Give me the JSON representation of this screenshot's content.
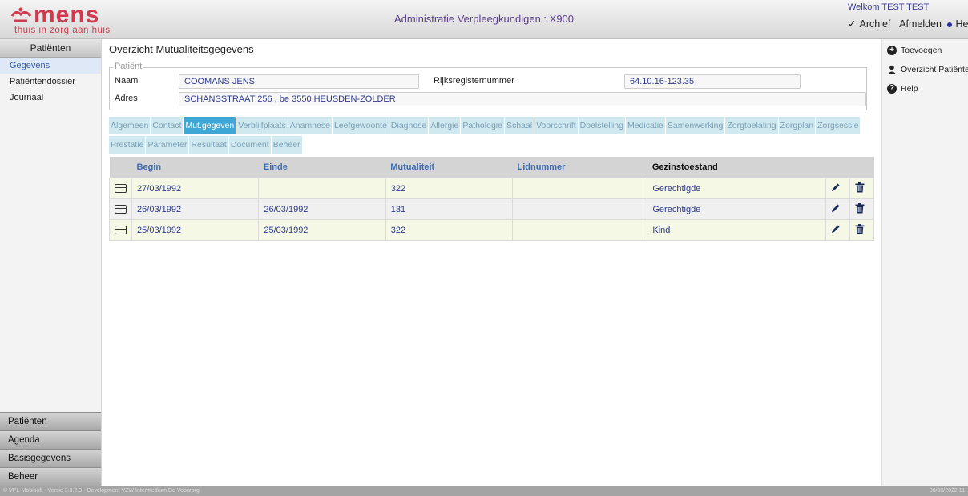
{
  "header": {
    "logo_word": "mens",
    "logo_tagline": "thuis in zorg aan huis",
    "title": "Administratie Verpleegkundigen : X900",
    "welcome": "Welkom TEST TEST",
    "nav": {
      "archief": "Archief",
      "afmelden": "Afmelden",
      "help": "Help"
    }
  },
  "leftnav": {
    "header": "Patiënten",
    "items": [
      "Gegevens",
      "Patiëntendossier",
      "Journaal"
    ],
    "bottom": [
      "Patiënten",
      "Agenda",
      "Basisgegevens",
      "Beheer"
    ]
  },
  "rightpanel": {
    "items": [
      {
        "label": "Toevoegen",
        "icon": "plus-circle-icon"
      },
      {
        "label": "Overzicht Patiënten",
        "icon": "user-icon"
      },
      {
        "label": "Help",
        "icon": "question-circle-icon"
      }
    ]
  },
  "main": {
    "title": "Overzicht Mutualiteitsgegevens",
    "patient": {
      "legend": "Patiënt",
      "naam_label": "Naam",
      "naam_value": "COOMANS JENS",
      "rijks_label": "Rijksregisternummer",
      "rijks_value": "64.10.16-123.35",
      "adres_label": "Adres",
      "adres_value": "SCHANSSTRAAT 256 , be 3550 HEUSDEN-ZOLDER"
    },
    "tabs": [
      "Algemeen",
      "Contact",
      "Mut.gegeven",
      "Verblijfplaats",
      "Anamnese",
      "Leefgewoonte",
      "Diagnose",
      "Allergie",
      "Pathologie",
      "Schaal",
      "Voorschrift",
      "Doelstelling",
      "Medicatie",
      "Samenwerking",
      "Zorgtoelating",
      "Zorgplan",
      "Zorgsessie",
      "Prestatie",
      "Parameter",
      "Resultaat",
      "Document",
      "Beheer"
    ],
    "active_tab": "Mut.gegeven",
    "table": {
      "headers": {
        "begin": "Begin",
        "einde": "Einde",
        "mutualiteit": "Mutualiteit",
        "lidnummer": "Lidnummer",
        "gezinstoestand": "Gezinstoestand"
      },
      "rows": [
        {
          "begin": "27/03/1992",
          "einde": "",
          "mutualiteit": "322",
          "lidnummer": "",
          "gezinstoestand": "Gerechtigde"
        },
        {
          "begin": "26/03/1992",
          "einde": "26/03/1992",
          "mutualiteit": "131",
          "lidnummer": "",
          "gezinstoestand": "Gerechtigde"
        },
        {
          "begin": "25/03/1992",
          "einde": "25/03/1992",
          "mutualiteit": "322",
          "lidnummer": "",
          "gezinstoestand": "Kind"
        }
      ]
    }
  },
  "footer": {
    "left": "© VPL-Mobisoft - Versie 3.0.2.3 - Development VZW Intermedium De Voorzorg",
    "right": "08/08/2022 11"
  },
  "colors": {
    "brand": "#cf3a4e",
    "active_tab": "#3fa7d6",
    "tab": "#d0e9f1",
    "link": "#3e6db0"
  }
}
